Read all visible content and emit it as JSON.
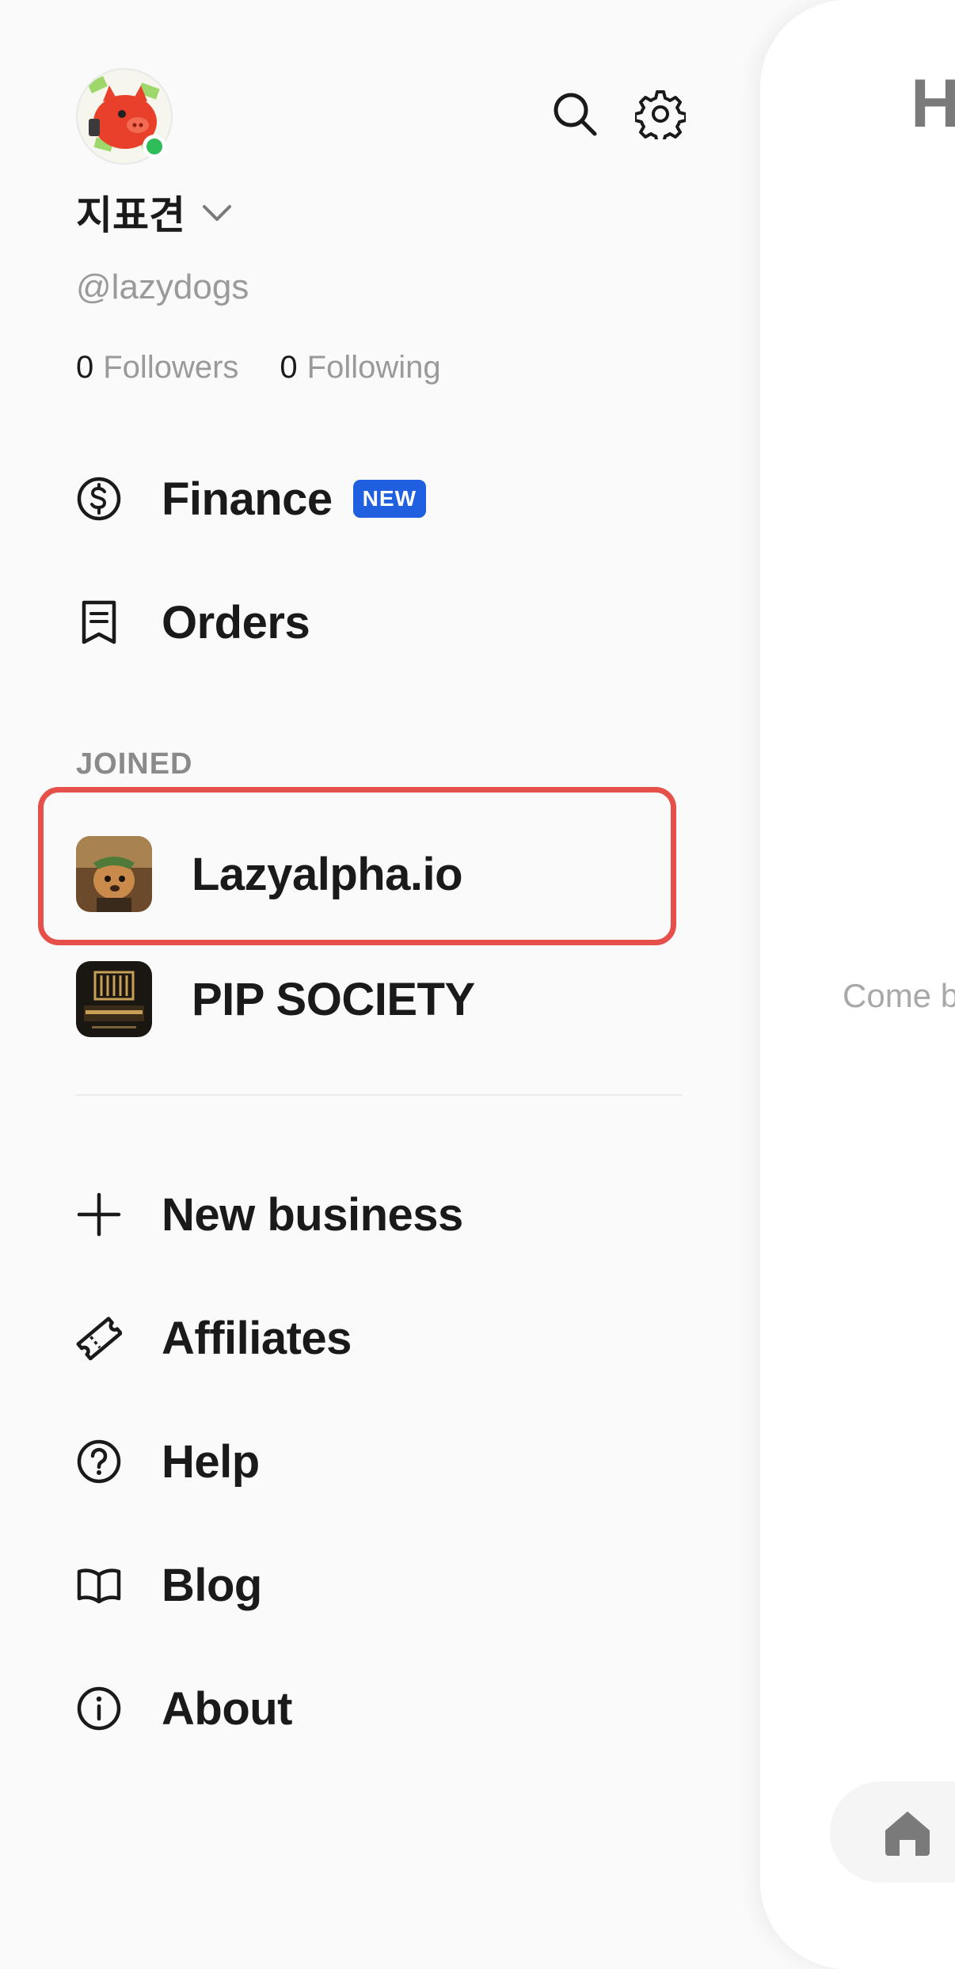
{
  "profile": {
    "display_name": "지표견",
    "handle": "@lazydogs",
    "followers_count": "0",
    "followers_label": "Followers",
    "following_count": "0",
    "following_label": "Following",
    "online": true
  },
  "header_icons": [
    "search-icon",
    "gear-icon"
  ],
  "menu": {
    "finance": {
      "label": "Finance",
      "badge": "NEW",
      "icon": "dollar-circle-icon"
    },
    "orders": {
      "label": "Orders",
      "icon": "receipt-icon"
    }
  },
  "joined": {
    "section_label": "JOINED",
    "items": [
      {
        "label": "Lazyalpha.io",
        "highlighted": true
      },
      {
        "label": "PIP SOCIETY",
        "highlighted": false
      }
    ]
  },
  "secondary_menu": [
    {
      "label": "New business",
      "icon": "plus-icon"
    },
    {
      "label": "Affiliates",
      "icon": "ticket-icon"
    },
    {
      "label": "Help",
      "icon": "help-circle-icon"
    },
    {
      "label": "Blog",
      "icon": "book-icon"
    },
    {
      "label": "About",
      "icon": "info-circle-icon"
    }
  ],
  "main": {
    "heading_partial": "H",
    "empty_text_partial": "Come b"
  },
  "colors": {
    "badge": "#1f5fe0",
    "highlight": "#e5504a",
    "online": "#2fbd5b"
  }
}
